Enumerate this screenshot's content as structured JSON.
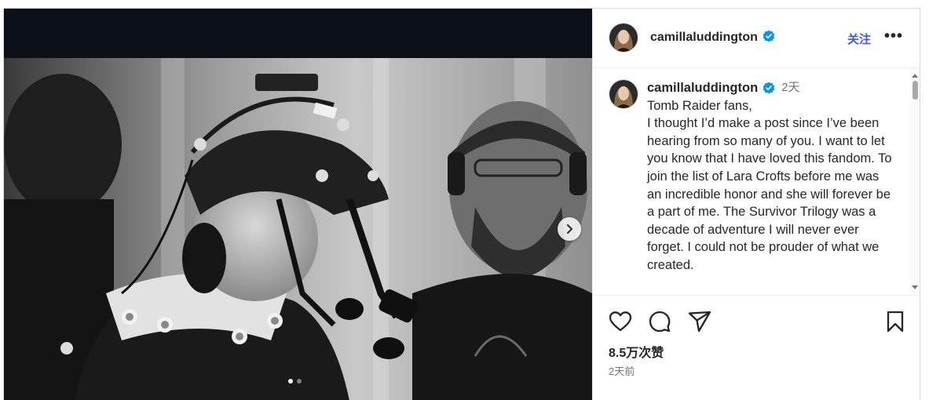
{
  "post": {
    "username": "camillaluddington",
    "follow_label": "关注",
    "more_label": "•••",
    "caption_time": "2天",
    "caption_text": "Tomb Raider fans,\nI thought I’d make a post since I’ve been hearing from so many of you.  I want to let you know that I have loved this fandom. To join the list of Lara Crofts before me was an incredible honor and she will forever be a part of me. The Survivor Trilogy was a decade of adventure I will never ever forget. I could not be prouder of what we created.",
    "likes": "8.5万次赞",
    "posted_ago": "2天前"
  },
  "icons": {
    "verified": "verified-badge-icon",
    "like": "heart-icon",
    "comment": "comment-icon",
    "share": "paper-plane-icon",
    "save": "bookmark-icon",
    "next": "chevron-right-icon"
  },
  "carousel": {
    "slides": 2,
    "active": 1
  },
  "colors": {
    "verified": "#0095f6",
    "follow": "#3b5bdb",
    "text": "#262626",
    "secondary": "#737373"
  }
}
